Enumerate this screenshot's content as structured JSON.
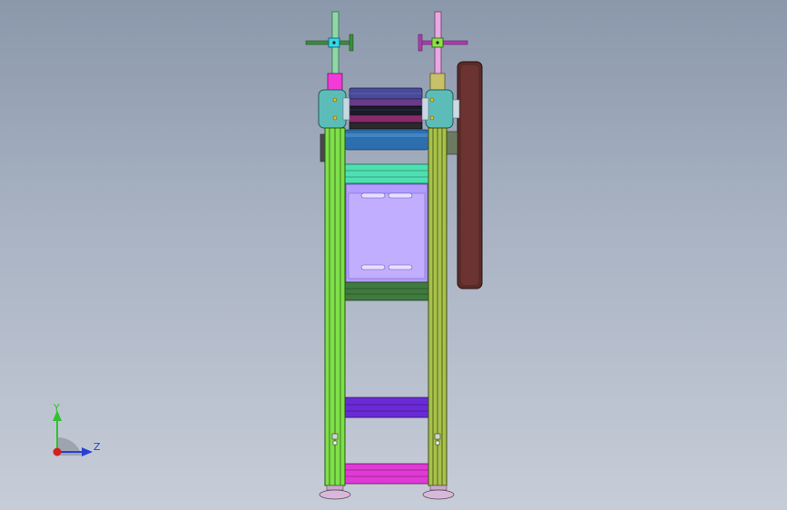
{
  "viewport": {
    "background_top": "#8b98ab",
    "background_bottom": "#c7cdd8"
  },
  "triad": {
    "y_label": "Y",
    "z_label": "Z",
    "y_color": "#2fc22f",
    "z_color": "#2a3fd6",
    "x_color": "#d42020"
  },
  "parts": {
    "left_post_color": "#7fe04a",
    "right_post_color": "#a7c24a",
    "roller_color": "#2d6fae",
    "teal_bar_color": "#4ee0b0",
    "plate_color": "#b39cff",
    "dark_green_bar_color": "#3f7a3f",
    "purple_bar_color": "#6a2bd6",
    "pink_bar_color": "#e03ad6",
    "wheel_color": "#5a2b28",
    "bearing_color": "#5cbdb8"
  }
}
